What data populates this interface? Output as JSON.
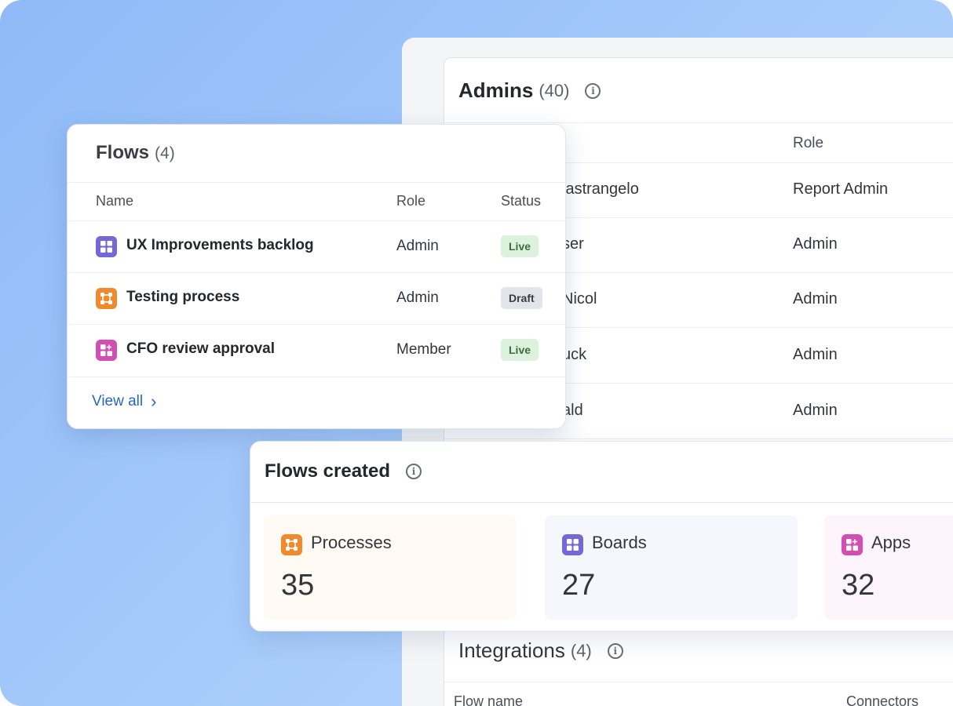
{
  "admins": {
    "title": "Admins",
    "count": "(40)",
    "info_icon": "i",
    "role_header": "Role",
    "rows": [
      {
        "name": "lastrangelo",
        "role": "Report Admin"
      },
      {
        "name": "ser",
        "role": "Admin"
      },
      {
        "name": "Nicol",
        "role": "Admin"
      },
      {
        "name": "uck",
        "role": "Admin"
      },
      {
        "name": "ald",
        "role": "Admin"
      }
    ]
  },
  "flows": {
    "title": "Flows",
    "count": "(4)",
    "headers": {
      "name": "Name",
      "role": "Role",
      "status": "Status"
    },
    "rows": [
      {
        "icon": "board-icon",
        "name": "UX Improvements backlog",
        "role": "Admin",
        "status": "Live"
      },
      {
        "icon": "process-icon",
        "name": "Testing process",
        "role": "Admin",
        "status": "Draft"
      },
      {
        "icon": "app-icon",
        "name": "CFO review approval",
        "role": "Member",
        "status": "Live"
      }
    ],
    "view_all": "View all",
    "chevron": "›"
  },
  "flows_created": {
    "title": "Flows created",
    "info_icon": "i",
    "stats": [
      {
        "icon": "process-icon",
        "label": "Processes",
        "value": "35"
      },
      {
        "icon": "board-icon",
        "label": "Boards",
        "value": "27"
      },
      {
        "icon": "app-icon",
        "label": "Apps",
        "value": "32"
      }
    ]
  },
  "integrations": {
    "title": "Integrations",
    "count": "(4)",
    "info_icon": "i",
    "headers": {
      "flow_name": "Flow name",
      "connectors": "Connectors"
    }
  },
  "colors": {
    "board": "#7368d6",
    "process": "#f08a2c",
    "app": "#d14fb3",
    "link": "#2767bf",
    "live_bg": "#dcf2dd",
    "draft_bg": "#e1e4e9"
  }
}
